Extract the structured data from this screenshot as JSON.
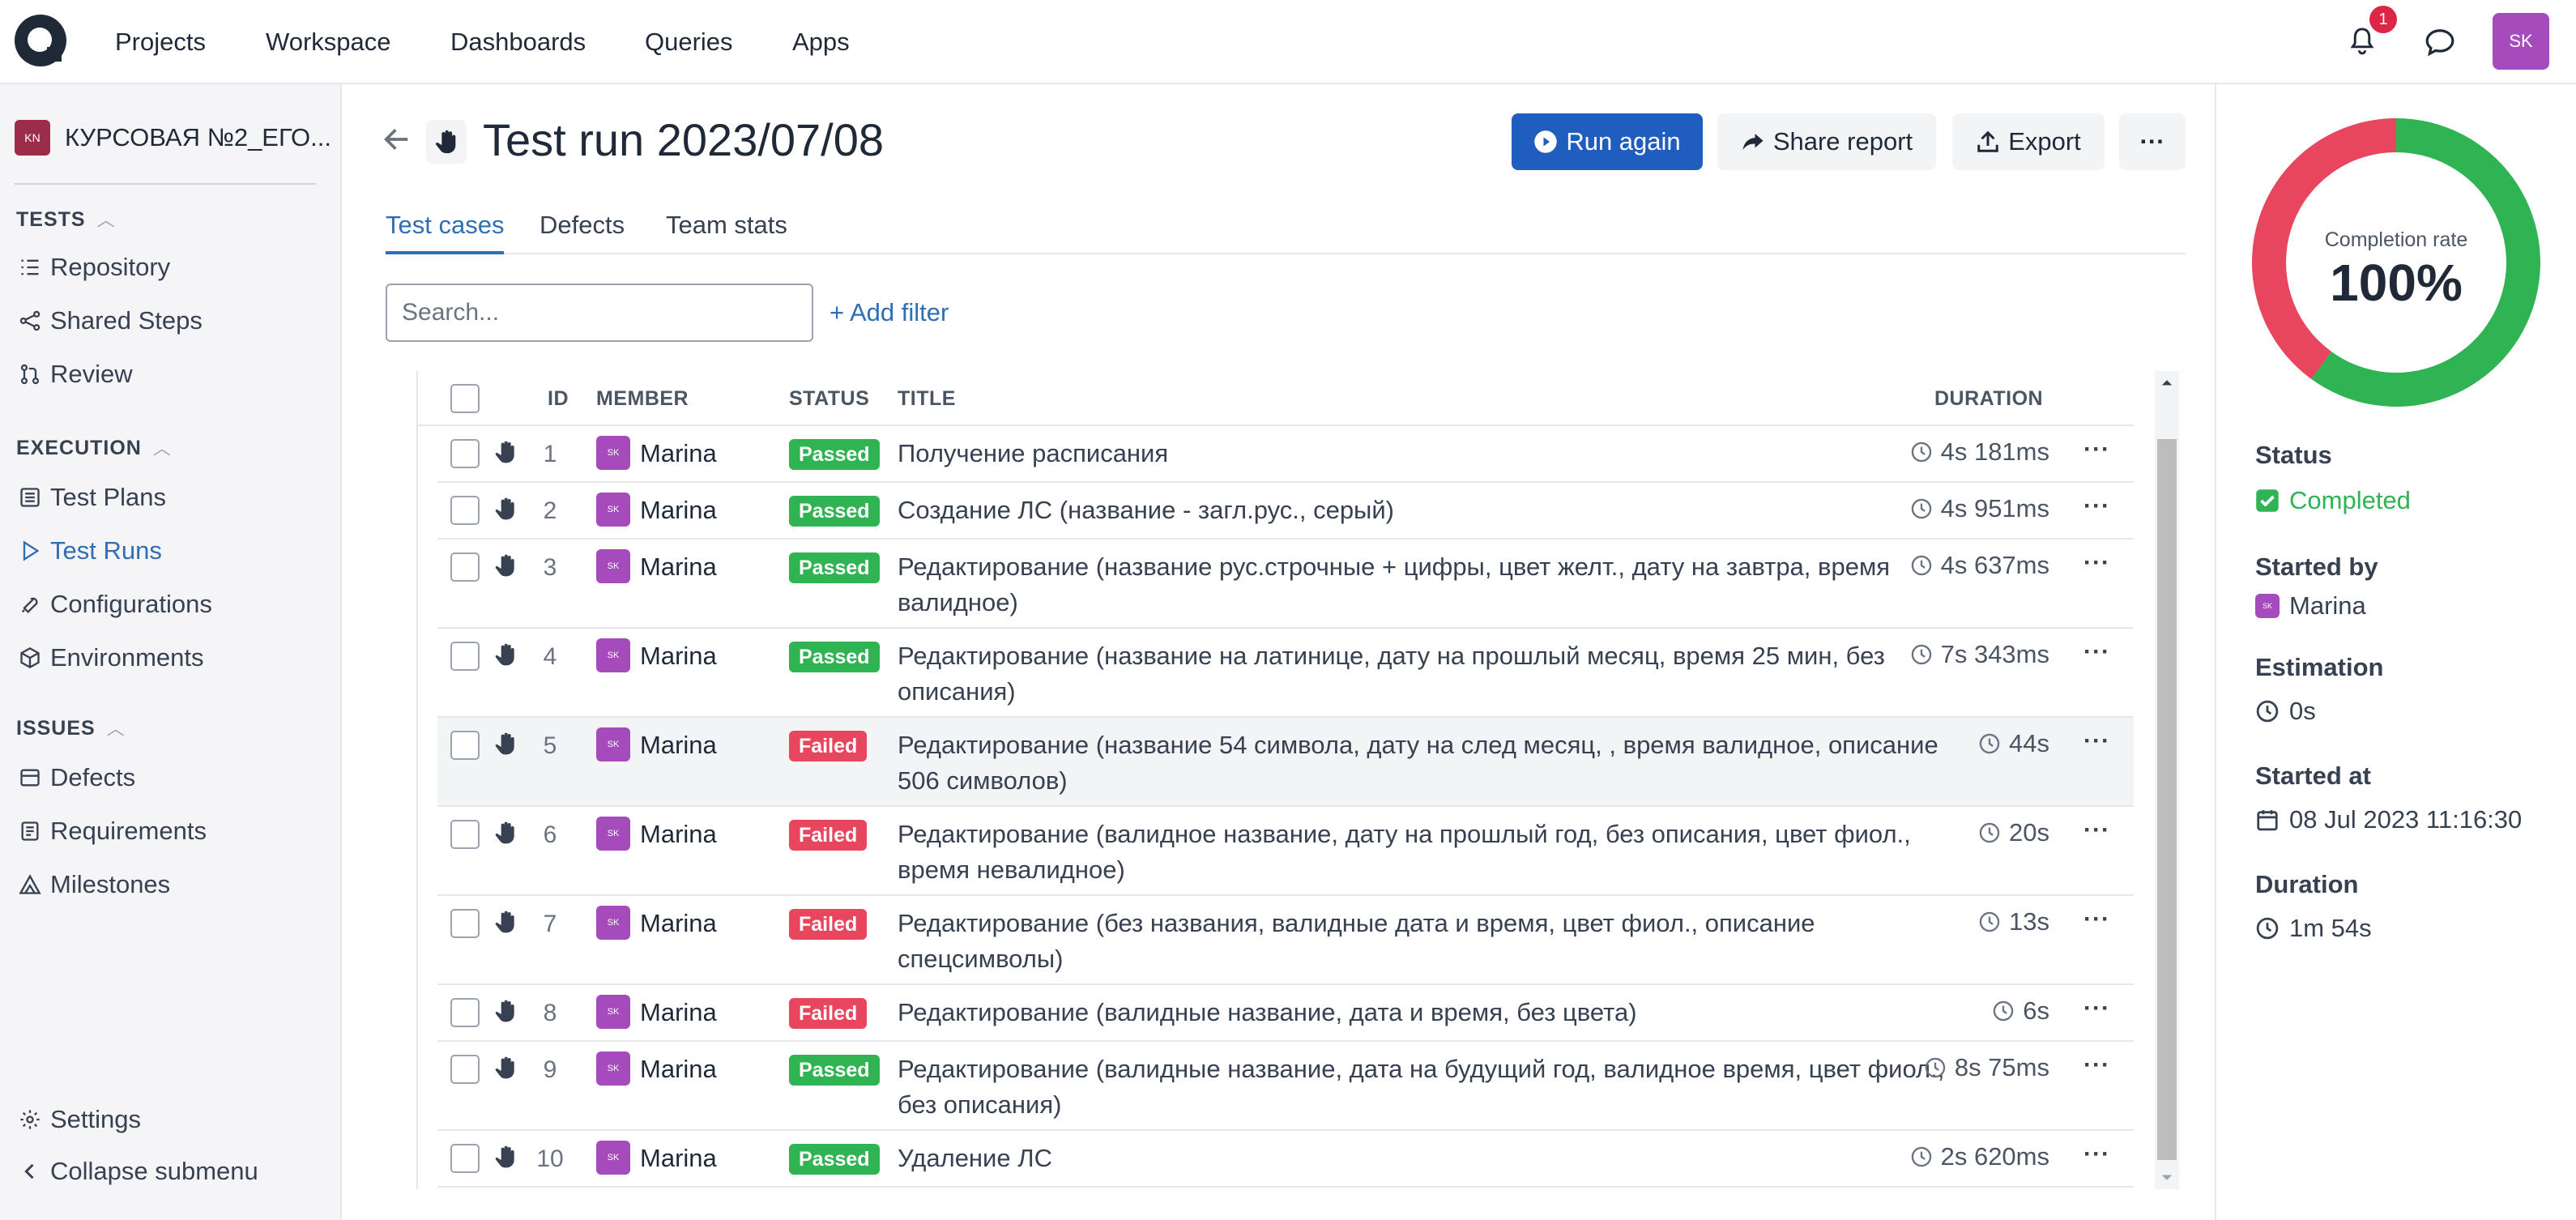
{
  "nav": {
    "items": [
      "Projects",
      "Workspace",
      "Dashboards",
      "Queries",
      "Apps"
    ],
    "notification_count": "1",
    "user_initials": "SK"
  },
  "sidebar": {
    "project_icon": "KN",
    "project_name": "КУРСОВАЯ №2_ЕГО...",
    "tests_header": "TESTS",
    "tests_items": [
      "Repository",
      "Shared Steps",
      "Review"
    ],
    "execution_header": "EXECUTION",
    "execution_items": [
      "Test Plans",
      "Test Runs",
      "Configurations",
      "Environments"
    ],
    "issues_header": "ISSUES",
    "issues_items": [
      "Defects",
      "Requirements",
      "Milestones"
    ],
    "settings": "Settings",
    "collapse": "Collapse submenu"
  },
  "header": {
    "title": "Test run 2023/07/08",
    "run_again": "Run again",
    "share_report": "Share report",
    "export": "Export",
    "more": "···"
  },
  "tabs": [
    "Test cases",
    "Defects",
    "Team stats"
  ],
  "search": {
    "placeholder": "Search...",
    "add_filter": "+ Add filter"
  },
  "table": {
    "columns": [
      "ID",
      "MEMBER",
      "STATUS",
      "TITLE",
      "DURATION"
    ],
    "rows": [
      {
        "id": "1",
        "member": "Marina",
        "status": "Passed",
        "title": "Получение расписания",
        "duration": "4s 181ms"
      },
      {
        "id": "2",
        "member": "Marina",
        "status": "Passed",
        "title": "Создание ЛС (название - загл.рус., серый)",
        "duration": "4s 951ms"
      },
      {
        "id": "3",
        "member": "Marina",
        "status": "Passed",
        "title": "Редактирование (название рус.строчные + цифры, цвет желт., дату на завтра, время валидное)",
        "duration": "4s 637ms"
      },
      {
        "id": "4",
        "member": "Marina",
        "status": "Passed",
        "title": "Редактирование (название на латинице, дату на прошлый месяц, время 25 мин, без описания)",
        "duration": "7s 343ms"
      },
      {
        "id": "5",
        "member": "Marina",
        "status": "Failed",
        "title": "Редактирование (название 54 символа, дату на след месяц, , время валидное, описание 506 символов)",
        "duration": "44s"
      },
      {
        "id": "6",
        "member": "Marina",
        "status": "Failed",
        "title": "Редактирование (валидное название, дату на прошлый год, без описания, цвет фиол., время невалидное)",
        "duration": "20s"
      },
      {
        "id": "7",
        "member": "Marina",
        "status": "Failed",
        "title": "Редактирование (без названия, валидные дата и время, цвет фиол., описание спецсимволы)",
        "duration": "13s"
      },
      {
        "id": "8",
        "member": "Marina",
        "status": "Failed",
        "title": "Редактирование (валидные название, дата и время, без цвета)",
        "duration": "6s"
      },
      {
        "id": "9",
        "member": "Marina",
        "status": "Passed",
        "title": "Редактирование (валидные название, дата на будущий год, валидное время, цвет фиол., без описания)",
        "duration": "8s 75ms"
      },
      {
        "id": "10",
        "member": "Marina",
        "status": "Passed",
        "title": "Удаление ЛС",
        "duration": "2s 620ms"
      }
    ]
  },
  "summary": {
    "completion_label": "Completion rate",
    "completion_value": "100%",
    "completion_fraction": 1.0,
    "passed_fraction": 0.6,
    "failed_fraction": 0.4,
    "status_label": "Status",
    "status_value": "Completed",
    "started_by_label": "Started by",
    "started_by_value": "Marina",
    "estimation_label": "Estimation",
    "estimation_value": "0s",
    "started_at_label": "Started at",
    "started_at_value": "08 Jul 2023 11:16:30",
    "duration_label": "Duration",
    "duration_value": "1m 54s"
  },
  "colors": {
    "accent": "#1f5dbf",
    "passed": "#2fb353",
    "failed": "#e8455e",
    "link": "#2f6db5"
  }
}
